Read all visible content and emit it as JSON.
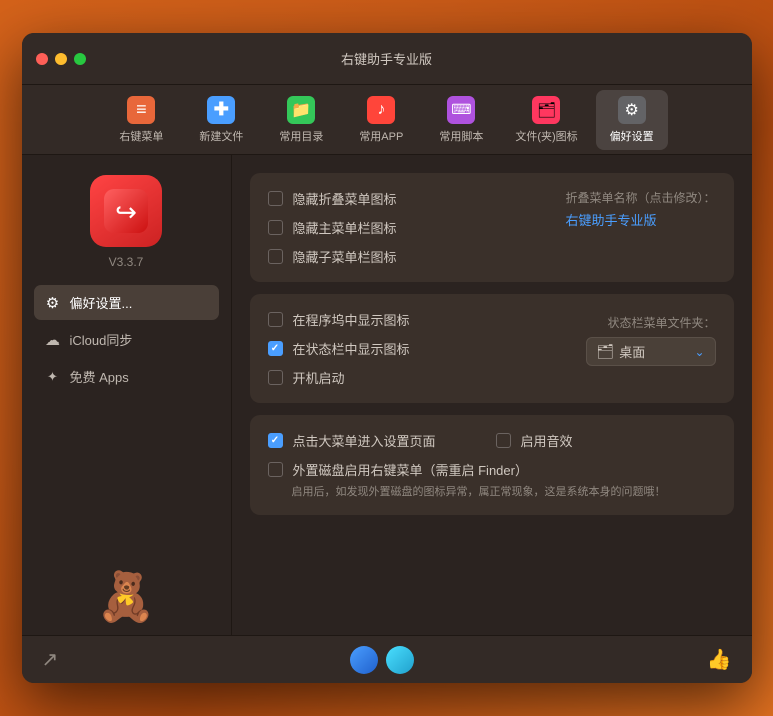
{
  "window": {
    "title": "右键助手专业版"
  },
  "toolbar": {
    "items": [
      {
        "id": "right-menu",
        "label": "右键菜单",
        "icon": "≡",
        "color": "orange",
        "active": false
      },
      {
        "id": "new-file",
        "label": "新建文件",
        "icon": "+",
        "color": "blue",
        "active": false
      },
      {
        "id": "common-dir",
        "label": "常用目录",
        "icon": "📁",
        "color": "green",
        "active": false
      },
      {
        "id": "common-app",
        "label": "常用APP",
        "icon": "♪",
        "color": "red",
        "active": false
      },
      {
        "id": "common-script",
        "label": "常用脚本",
        "icon": "⌨",
        "color": "purple",
        "active": false
      },
      {
        "id": "file-icon",
        "label": "文件(夹)图标",
        "icon": "🗂",
        "color": "pink",
        "active": false
      },
      {
        "id": "preferences",
        "label": "偏好设置",
        "icon": "⚙",
        "color": "gray",
        "active": true
      }
    ]
  },
  "sidebar": {
    "app_version": "V3.3.7",
    "nav_items": [
      {
        "id": "preferences",
        "label": "偏好设置...",
        "icon": "⚙",
        "active": true
      },
      {
        "id": "icloud",
        "label": "iCloud同步",
        "icon": "☁",
        "active": false
      },
      {
        "id": "free-apps",
        "label": "免费 Apps",
        "icon": "✦",
        "active": false
      }
    ]
  },
  "settings": {
    "panel1": {
      "items": [
        {
          "id": "hide-fold-icon",
          "label": "隐藏折叠菜单图标",
          "checked": false
        },
        {
          "id": "hide-main-icon",
          "label": "隐藏主菜单栏图标",
          "checked": false
        },
        {
          "id": "hide-sub-icon",
          "label": "隐藏子菜单栏图标",
          "checked": false
        }
      ],
      "right_label": "折叠菜单名称（点击修改）：",
      "right_value": "右键助手专业版"
    },
    "panel2": {
      "items": [
        {
          "id": "show-in-dock",
          "label": "在程序坞中显示图标",
          "checked": false
        },
        {
          "id": "show-in-status",
          "label": "在状态栏中显示图标",
          "checked": true
        },
        {
          "id": "auto-launch",
          "label": "开机启动",
          "checked": false
        }
      ],
      "folder_label": "状态栏菜单文件夹：",
      "folder_value": "桌面"
    },
    "panel3": {
      "row1_left": {
        "id": "click-main-settings",
        "label": "点击大菜单进入设置页面",
        "checked": true
      },
      "row1_right": {
        "id": "enable-sound",
        "label": "启用音效",
        "checked": false
      },
      "row2": {
        "id": "external-disk",
        "label": "外置磁盘启用右键菜单（需重启 Finder）",
        "checked": false,
        "warning": "启用后，如发现外置磁盘的图标异常，属正常现象，这是系统本身的问题哦！"
      }
    }
  },
  "footer": {
    "left_icon": "export",
    "right_icon": "thumbsup"
  }
}
